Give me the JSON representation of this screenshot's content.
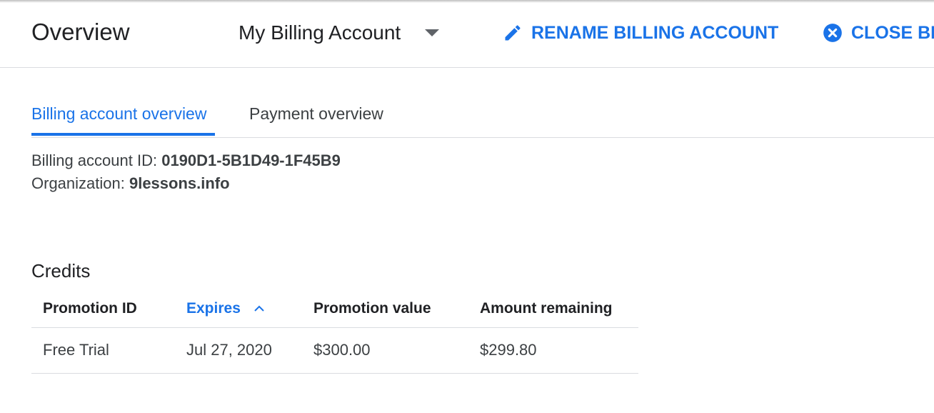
{
  "header": {
    "title": "Overview",
    "account_name": "My Billing Account",
    "rename_label": "RENAME BILLING ACCOUNT",
    "close_label": "CLOSE BIL",
    "accent": "#1a73e8"
  },
  "tabs": [
    {
      "label": "Billing account overview",
      "active": true
    },
    {
      "label": "Payment overview",
      "active": false
    }
  ],
  "account_info": {
    "id_label": "Billing account ID: ",
    "id_value": "0190D1-5B1D49-1F45B9",
    "org_label": "Organization: ",
    "org_value": "9lessons.info"
  },
  "credits": {
    "title": "Credits",
    "columns": [
      "Promotion ID",
      "Expires",
      "Promotion value",
      "Amount remaining"
    ],
    "sorted_column": "Expires",
    "sort_direction": "ascending",
    "rows": [
      [
        "Free Trial",
        "Jul 27, 2020",
        "$300.00",
        "$299.80"
      ]
    ]
  },
  "icons": [
    "pencil-icon",
    "close-circle-icon",
    "dropdown-caret-icon",
    "sort-ascending-icon"
  ]
}
